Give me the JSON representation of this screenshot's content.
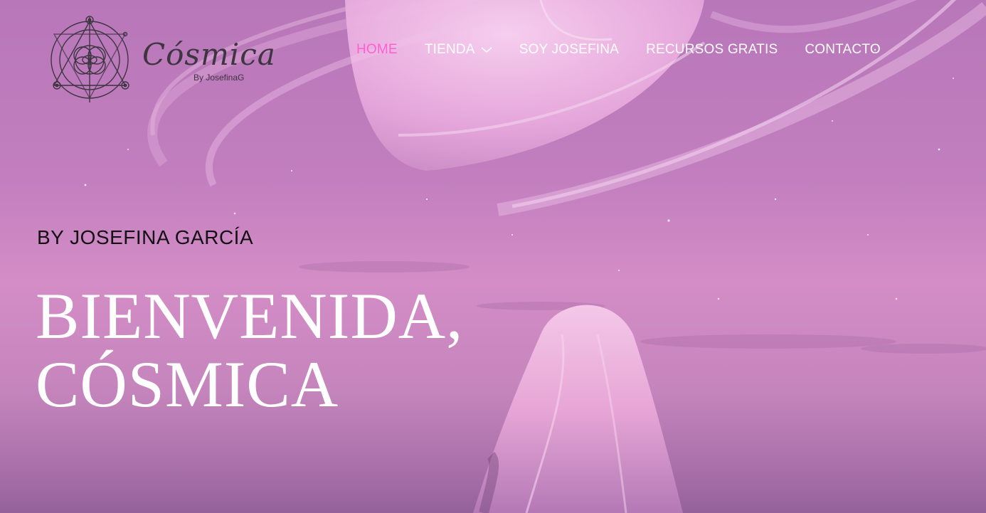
{
  "logo": {
    "wordmark": "Cósmica",
    "byline": "By JosefinaG"
  },
  "nav": {
    "items": [
      {
        "label": "HOME",
        "active": true
      },
      {
        "label": "TIENDA",
        "has_dropdown": true,
        "icon": "chevron-down-icon"
      },
      {
        "label": "SOY JOSEFINA"
      },
      {
        "label": "RECURSOS GRATIS"
      },
      {
        "label": "CONTACTO"
      }
    ]
  },
  "hero": {
    "eyebrow": "BY JOSEFINA GARCÍA",
    "headline_line1": "BIENVENIDA,",
    "headline_line2": "CÓSMICA"
  },
  "colors": {
    "accent": "#ff5fd0",
    "nav_text": "#ffffff",
    "headline": "#ffffff",
    "eyebrow": "#131014",
    "background": "#c27fbf"
  }
}
